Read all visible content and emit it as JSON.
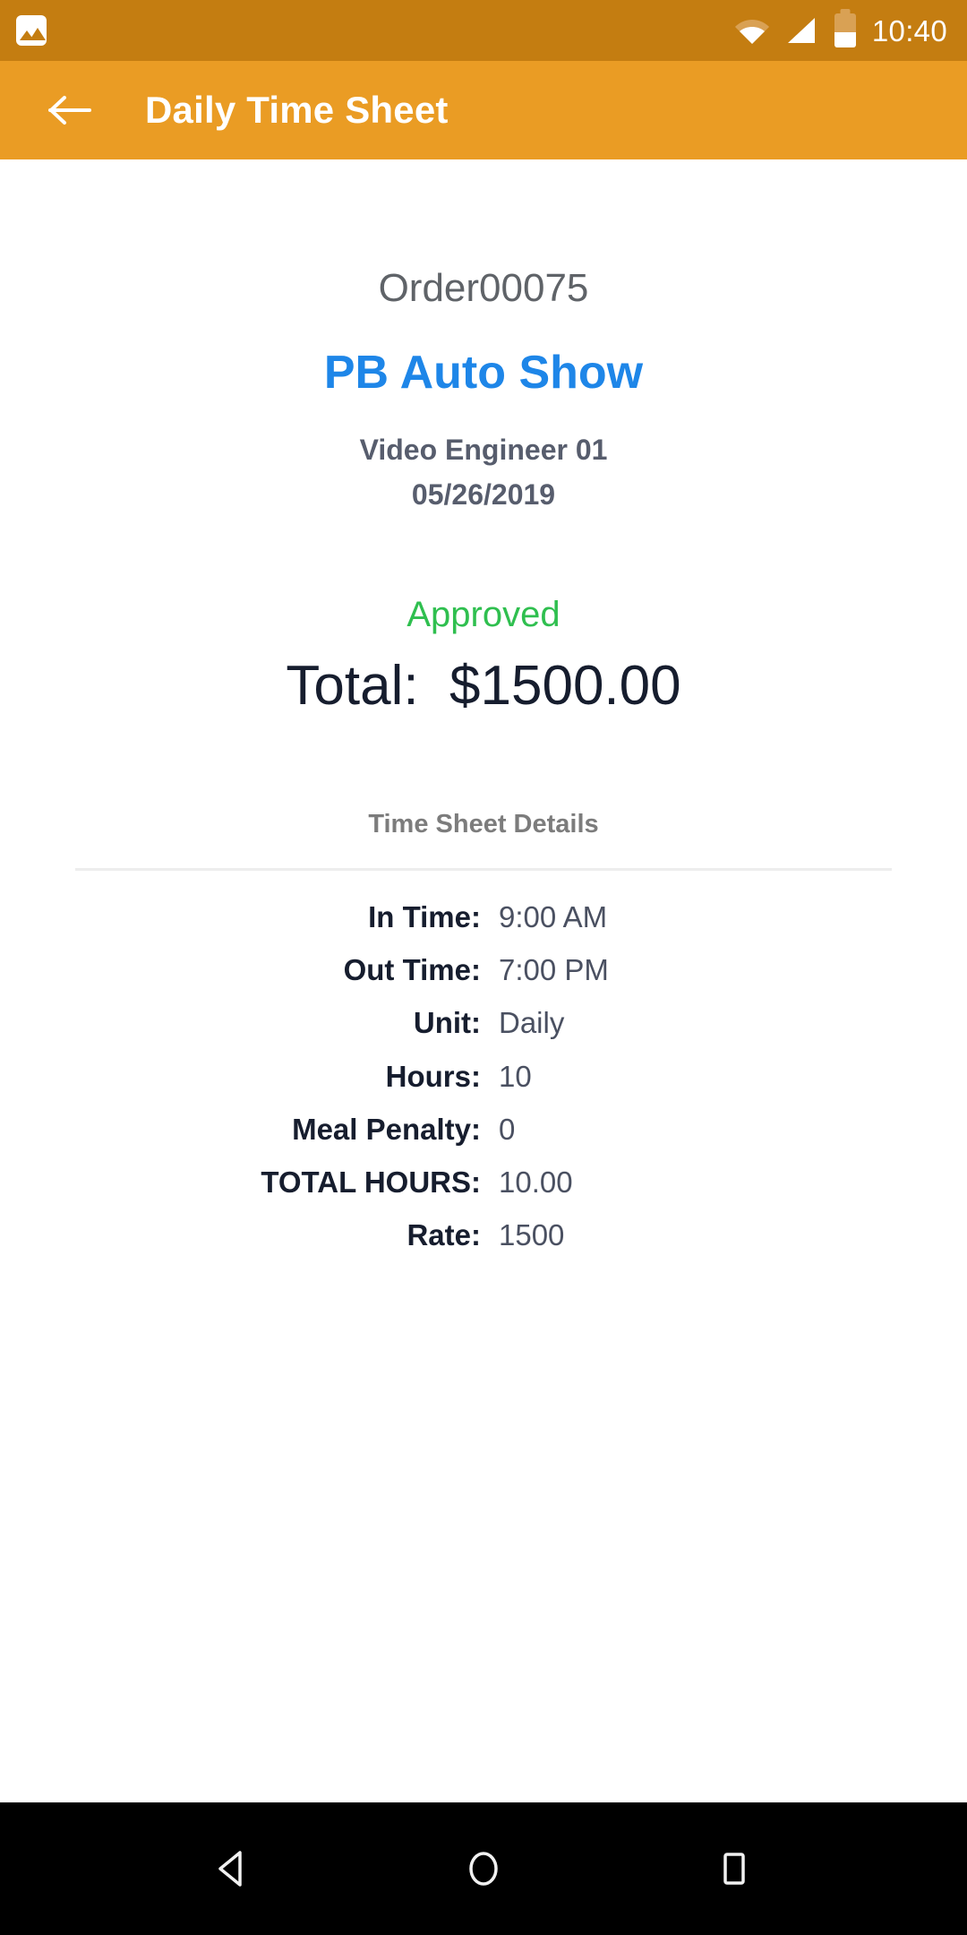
{
  "status_bar": {
    "gallery_icon": "image-gallery-icon",
    "wifi_icon": "wifi-icon",
    "signal_icon": "cellular-signal-icon",
    "battery_icon": "battery-icon",
    "clock": "10:40"
  },
  "app_bar": {
    "back_icon": "back-arrow-icon",
    "title": "Daily Time Sheet",
    "background_color": "#EA9C24"
  },
  "summary": {
    "order_number": "Order00075",
    "event_name": "PB Auto Show",
    "event_name_color": "#1E86E8",
    "role": "Video Engineer 01",
    "date": "05/26/2019",
    "status": "Approved",
    "status_color": "#2FBF4F",
    "total": "Total:  $1500.00"
  },
  "details": {
    "heading": "Time Sheet Details",
    "rows": [
      {
        "label": "In Time:",
        "value": "9:00 AM"
      },
      {
        "label": "Out Time:",
        "value": "7:00 PM"
      },
      {
        "label": "Unit:",
        "value": "Daily"
      },
      {
        "label": "Hours:",
        "value": "10"
      },
      {
        "label": "Meal Penalty:",
        "value": "0"
      },
      {
        "label": "TOTAL HOURS:",
        "value": "10.00"
      },
      {
        "label": "Rate:",
        "value": "1500"
      }
    ]
  },
  "nav_bar": {
    "back_icon": "nav-back-triangle-icon",
    "home_icon": "nav-home-circle-icon",
    "recents_icon": "nav-recents-square-icon"
  }
}
